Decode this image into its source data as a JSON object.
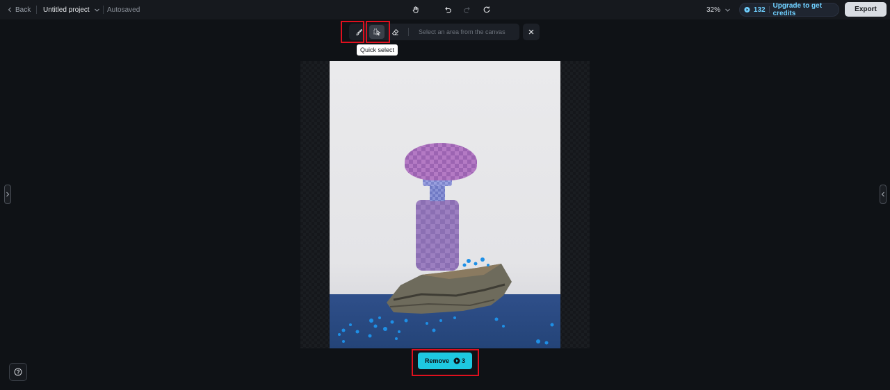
{
  "topbar": {
    "back_label": "Back",
    "project_name": "Untitled project",
    "save_status": "Autosaved",
    "zoom_level": "32%",
    "credits_count": "132",
    "upgrade_label": "Upgrade to get credits",
    "export_label": "Export",
    "center_tools": [
      "hand-icon",
      "undo-icon",
      "redo-icon",
      "refresh-icon"
    ]
  },
  "selection_toolbar": {
    "tools": [
      {
        "name": "brush",
        "active": false
      },
      {
        "name": "quick-select",
        "active": true
      },
      {
        "name": "eraser",
        "active": false
      }
    ],
    "hint": "Select an area from the canvas",
    "tooltip": "Quick select"
  },
  "canvas": {
    "image_description": "Purple-highlighted perfume bottle with flower cap on a rock, blue surface with blue pebbles"
  },
  "remove_button": {
    "label": "Remove",
    "cost": "3"
  },
  "colors": {
    "accent": "#1ec8e0",
    "credits_text": "#6fd0ff",
    "highlight_box": "#e0101e",
    "background": "#0f1216"
  }
}
